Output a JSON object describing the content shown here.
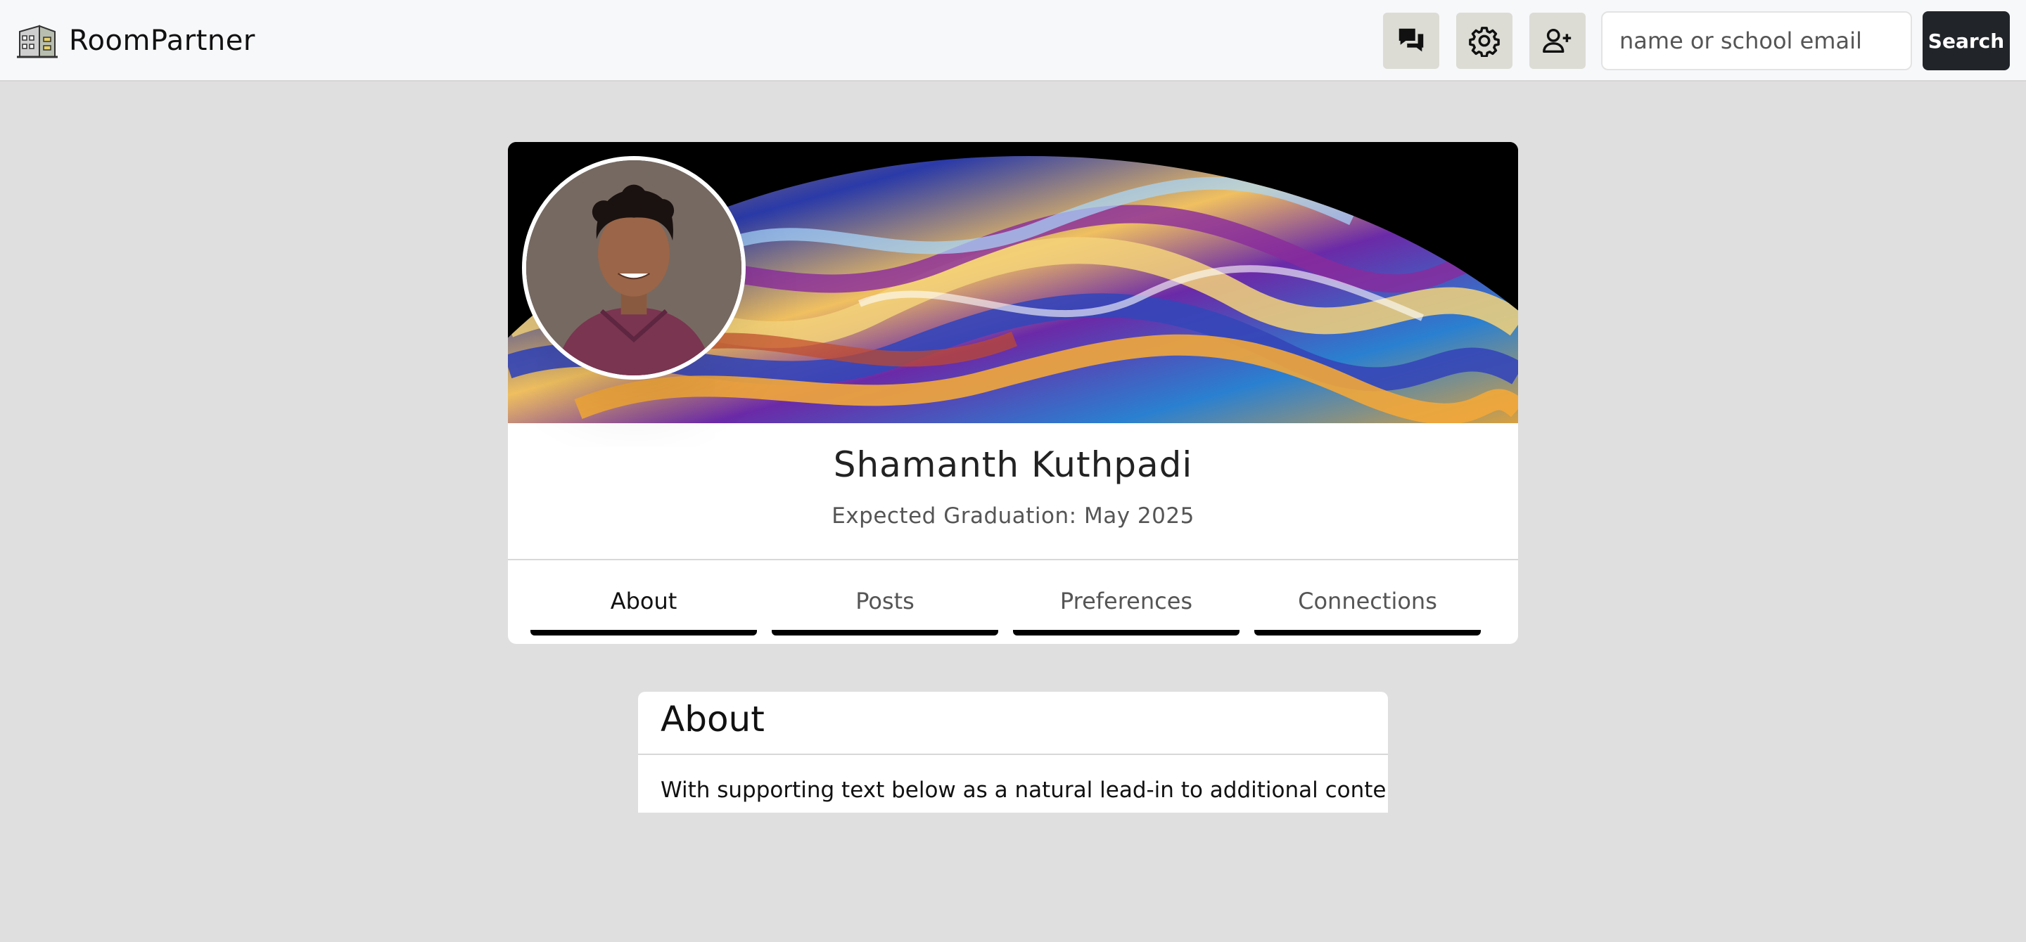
{
  "navbar": {
    "brand": "RoomPartner",
    "search": {
      "placeholder": "name or school email",
      "button_label": "Search"
    },
    "icons": [
      "chat-icon",
      "gear-icon",
      "add-user-icon"
    ],
    "colors": {
      "background": "#f7f8fa",
      "icon_button": "#dcdcd5",
      "search_button": "#212529"
    }
  },
  "profile": {
    "name": "Shamanth Kuthpadi",
    "subtitle": "Expected Graduation: May 2025",
    "tabs": [
      {
        "label": "About",
        "active": true
      },
      {
        "label": "Posts",
        "active": false
      },
      {
        "label": "Preferences",
        "active": false
      },
      {
        "label": "Connections",
        "active": false
      }
    ]
  },
  "about": {
    "title": "About",
    "text": "With supporting text below as a natural lead-in to additional content."
  },
  "colors": {
    "page_background": "#e0dfdf"
  }
}
